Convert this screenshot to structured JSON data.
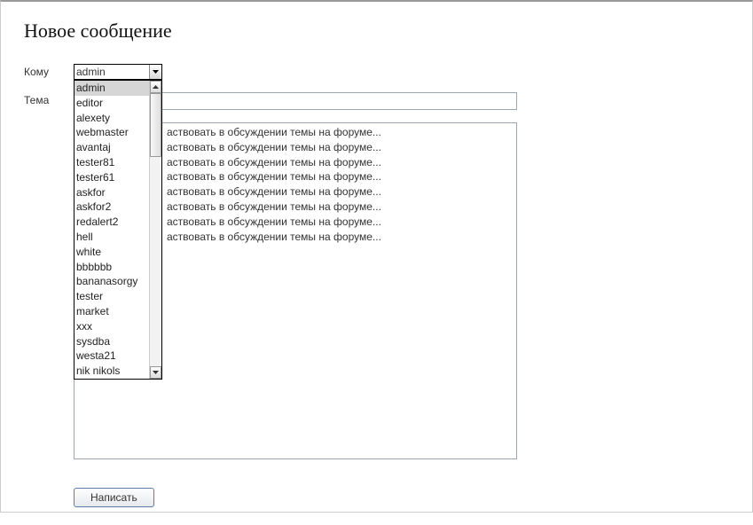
{
  "title": "Новое сообщение",
  "labels": {
    "to": "Кому",
    "subject": "Тема"
  },
  "recipient_select": {
    "value": "admin",
    "options": [
      "admin",
      "editor",
      "alexety",
      "webmaster",
      "avantaj",
      "tester81",
      "tester61",
      "askfor",
      "askfor2",
      "redalert2",
      "hell",
      "white",
      "bbbbbb",
      "bananasorgy",
      "tester",
      "market",
      "xxx",
      "sysdba",
      "westa21",
      "nik nikols"
    ]
  },
  "subject_value": "",
  "body_lines": [
    "аствовать в обсуждении темы на форуме...",
    "аствовать в обсуждении темы на форуме...",
    "аствовать в обсуждении темы на форуме...",
    "аствовать в обсуждении темы на форуме...",
    "аствовать в обсуждении темы на форуме...",
    "аствовать в обсуждении темы на форуме...",
    "аствовать в обсуждении темы на форуме...",
    "аствовать в обсуждении темы на форуме..."
  ],
  "submit_label": "Написать"
}
